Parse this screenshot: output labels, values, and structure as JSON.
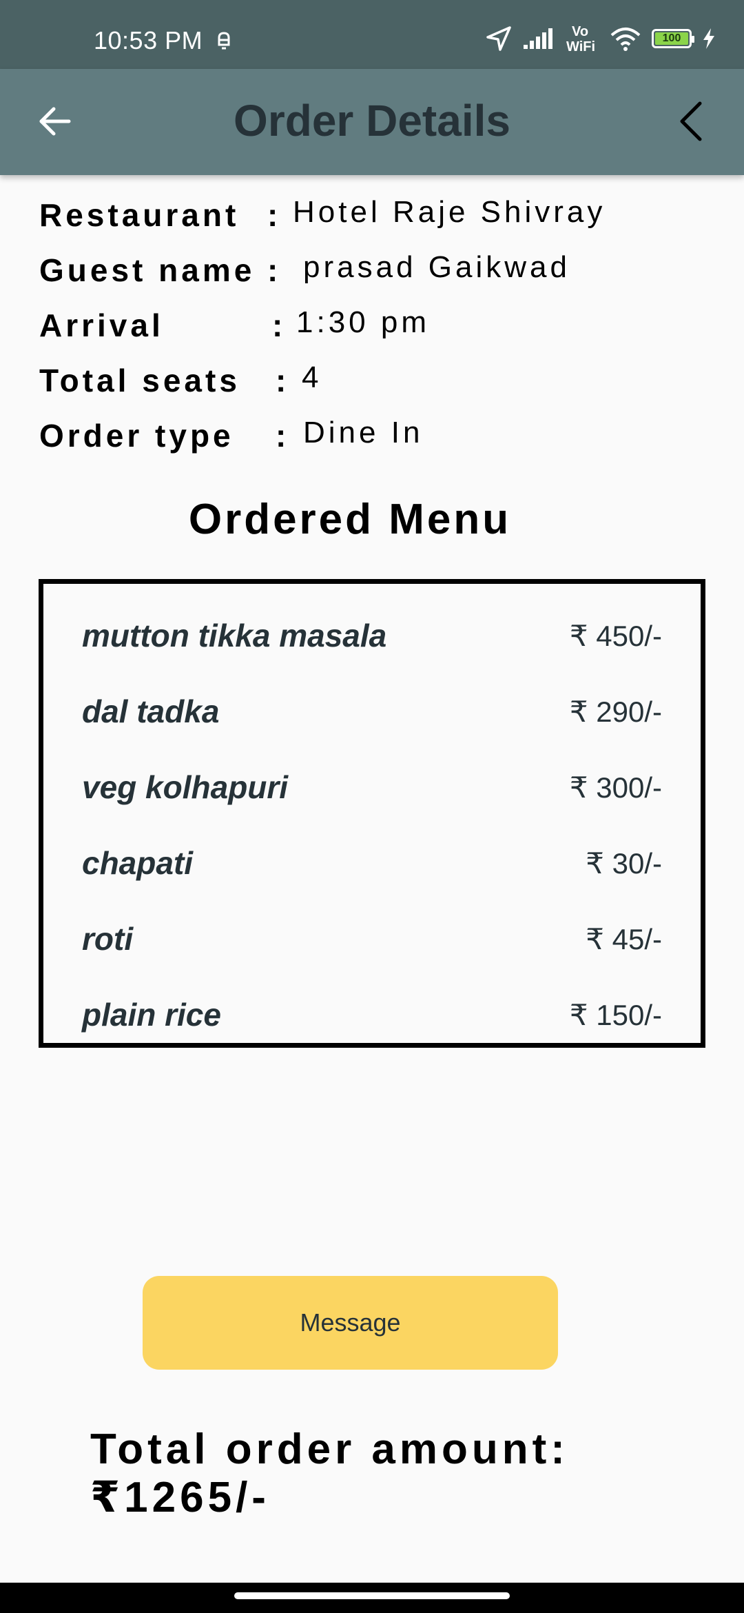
{
  "status_bar": {
    "time": "10:53 PM",
    "battery_level": "100"
  },
  "app_bar": {
    "title": "Order Details"
  },
  "details": [
    {
      "label": "Restaurant",
      "value": "Hotel Raje Shivray"
    },
    {
      "label": "Guest name",
      "value": "prasad Gaikwad"
    },
    {
      "label": "Arrival",
      "value": "1:30 pm"
    },
    {
      "label": "Total seats",
      "value": "4"
    },
    {
      "label": "Order type",
      "value": "Dine In"
    }
  ],
  "details_separator": ":",
  "menu": {
    "heading": "Ordered Menu",
    "items": [
      {
        "name": "mutton tikka masala",
        "price": "₹ 450/-"
      },
      {
        "name": "dal tadka",
        "price": "₹ 290/-"
      },
      {
        "name": "veg kolhapuri",
        "price": "₹ 300/-"
      },
      {
        "name": "chapati",
        "price": "₹ 30/-"
      },
      {
        "name": "roti",
        "price": "₹ 45/-"
      },
      {
        "name": "plain rice",
        "price": "₹ 150/-"
      }
    ]
  },
  "message_button": {
    "label": "Message"
  },
  "total": {
    "label": "Total order amount:",
    "amount": "₹1265/-"
  },
  "colors": {
    "status_bar": "#4b6264",
    "app_bar": "#617c80",
    "title_text": "#263238",
    "button": "#fbd561",
    "battery": "#8bd44a"
  },
  "icons": {
    "back": "arrow-left-icon",
    "menu_back": "chevron-left-icon",
    "location": "navigation-arrow-icon",
    "signal": "signal-bars-icon",
    "vowifi": "vowifi-icon",
    "wifi": "wifi-icon",
    "battery": "battery-icon",
    "charging": "lightning-icon",
    "alarm": "bell-icon"
  }
}
